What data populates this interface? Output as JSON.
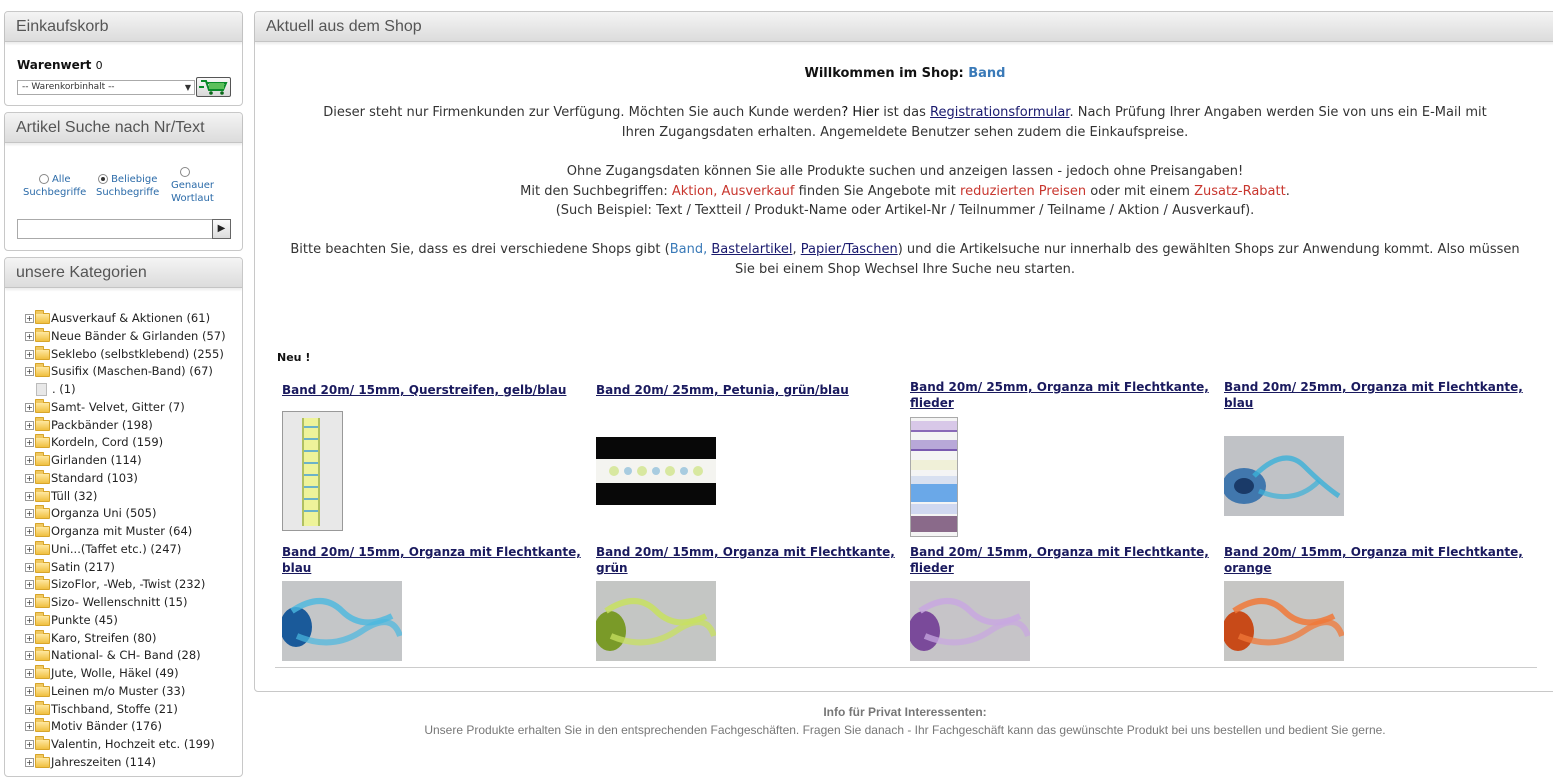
{
  "cart": {
    "title": "Einkaufskorb",
    "value_label": "Warenwert",
    "value": "0",
    "select_value": "-- Warenkorbinhalt --",
    "cart_button_icon": "cart-icon"
  },
  "search": {
    "title": "Artikel Suche nach Nr/Text",
    "options": [
      {
        "line1": "Alle",
        "line2": "Suchbegriffe",
        "checked": false
      },
      {
        "line1": "Beliebige",
        "line2": "Suchbegriffe",
        "checked": true
      },
      {
        "line1": "Genauer",
        "line2": "Wortlaut",
        "checked": false
      }
    ],
    "input_value": "",
    "go_icon": "arrow-right-icon",
    "go_symbol": "▶"
  },
  "categories": {
    "title": "unsere Kategorien",
    "items": [
      {
        "label": "Ausverkauf & Aktionen (61)",
        "type": "folder"
      },
      {
        "label": "Neue Bänder & Girlanden (57)",
        "type": "folder"
      },
      {
        "label": "Seklebo (selbstklebend) (255)",
        "type": "folder"
      },
      {
        "label": "Susifix (Maschen-Band) (67)",
        "type": "folder"
      },
      {
        "label": ". (1)",
        "type": "page"
      },
      {
        "label": "Samt- Velvet, Gitter (7)",
        "type": "folder"
      },
      {
        "label": "Packbänder (198)",
        "type": "folder"
      },
      {
        "label": "Kordeln, Cord (159)",
        "type": "folder"
      },
      {
        "label": "Girlanden (114)",
        "type": "folder"
      },
      {
        "label": "Standard (103)",
        "type": "folder"
      },
      {
        "label": "Tüll (32)",
        "type": "folder"
      },
      {
        "label": "Organza Uni (505)",
        "type": "folder"
      },
      {
        "label": "Organza mit Muster (64)",
        "type": "folder"
      },
      {
        "label": "Uni...(Taffet etc.) (247)",
        "type": "folder"
      },
      {
        "label": "Satin (217)",
        "type": "folder"
      },
      {
        "label": "SizoFlor, -Web, -Twist (232)",
        "type": "folder"
      },
      {
        "label": "Sizo- Wellenschnitt (15)",
        "type": "folder"
      },
      {
        "label": "Punkte (45)",
        "type": "folder"
      },
      {
        "label": "Karo, Streifen (80)",
        "type": "folder"
      },
      {
        "label": "National- & CH- Band (28)",
        "type": "folder"
      },
      {
        "label": "Jute, Wolle, Häkel (49)",
        "type": "folder"
      },
      {
        "label": "Leinen m/o Muster (33)",
        "type": "folder"
      },
      {
        "label": "Tischband, Stoffe (21)",
        "type": "folder"
      },
      {
        "label": "Motiv Bänder (176)",
        "type": "folder"
      },
      {
        "label": "Valentin, Hochzeit etc. (199)",
        "type": "folder"
      },
      {
        "label": "Jahreszeiten (114)",
        "type": "folder"
      }
    ]
  },
  "main": {
    "title": "Aktuell aus dem Shop",
    "welcome_prefix": "Willkommen im Shop:",
    "welcome_shop": "Band",
    "p1_a": "Dieser steht nur Firmenkunden zur Verfügung. Möchten Sie auch Kunde werden",
    "p1_b": "? Hier",
    "p1_c": " ist das ",
    "p1_link": "Registrationsformular",
    "p1_d": ". Nach Prüfung Ihrer Angaben werden Sie von uns ein E-Mail mit",
    "p1_line2": "Ihren Zugangsdaten erhalten. Angemeldete Benutzer sehen zudem die Einkaufspreise.",
    "p2_line1": "Ohne Zugangsdaten können Sie alle Produkte suchen und anzeigen lassen - jedoch ohne Preisangaben!",
    "p2_a": "Mit den Suchbegriffen: ",
    "p2_red1": "Aktion, Ausverkauf",
    "p2_b": " finden Sie Angebote mit ",
    "p2_red2": "reduzierten Preisen",
    "p2_c": " oder mit einem ",
    "p2_red3": "Zusatz-Rabatt",
    "p2_d": ".",
    "p2_line3": "(Such Beispiel: Text / Textteil / Produkt-Name oder Artikel-Nr / Teilnummer / Teilname / Aktion / Ausverkauf).",
    "p3_a": "Bitte beachten Sie, dass es drei verschiedene Shops gibt (",
    "p3_band": "Band,",
    "p3_link1": "Bastelartikel",
    "p3_sep": ", ",
    "p3_link2": "Papier/Taschen",
    "p3_b": ") und die Artikelsuche nur innerhalb des gewählten Shops zur Anwendung kommt. Also müssen",
    "p3_line2": "Sie bei einem Shop Wechsel Ihre Suche neu starten.",
    "new_label": "Neu !",
    "products": [
      {
        "title": "Band 20m/ 15mm, Querstreifen, gelb/blau"
      },
      {
        "title": "Band 20m/ 25mm, Petunia, grün/blau"
      },
      {
        "title": "Band 20m/ 25mm, Organza mit Flechtkante, flieder"
      },
      {
        "title": "Band 20m/ 25mm, Organza mit Flechtkante, blau"
      },
      {
        "title": "Band 20m/ 15mm, Organza mit Flechtkante, blau"
      },
      {
        "title": "Band 20m/ 15mm, Organza mit Flechtkante, grün"
      },
      {
        "title": "Band 20m/ 15mm, Organza mit Flechtkante, flieder"
      },
      {
        "title": "Band 20m/ 15mm, Organza mit Flechtkante, orange"
      }
    ]
  },
  "footer": {
    "heading": "Info für Privat Interessenten:",
    "text": "Unsere Produkte erhalten Sie in den entsprechenden Fachgeschäften. Fragen Sie danach - Ihr Fachgeschäft kann das gewünschte Produkt bei uns bestellen und bedient Sie gerne."
  }
}
